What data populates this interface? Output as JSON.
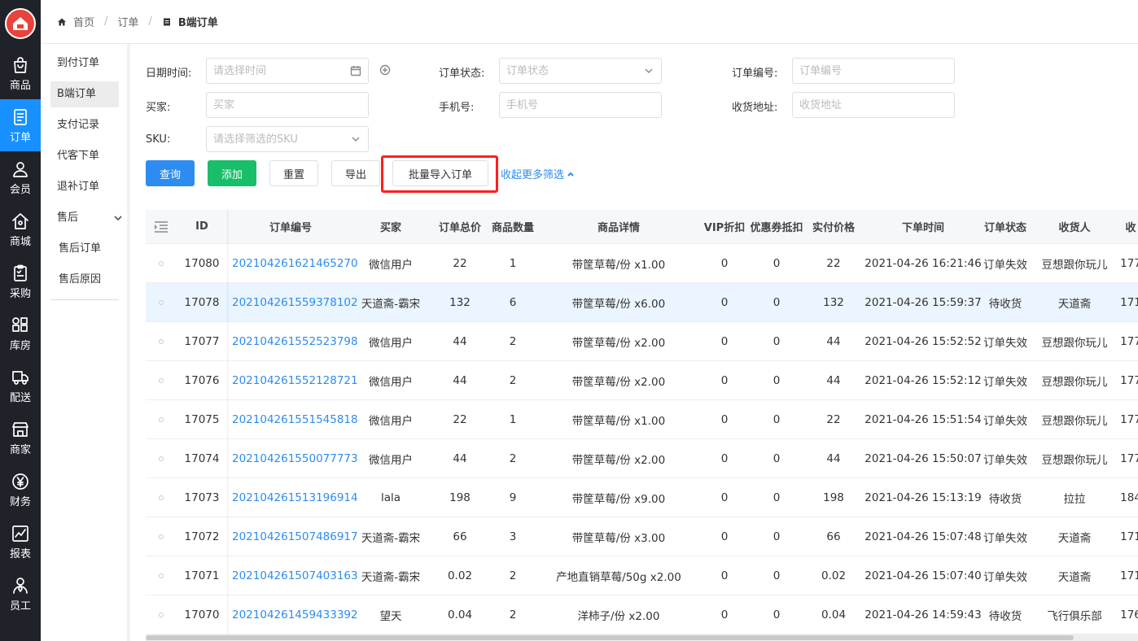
{
  "rail": {
    "items": [
      {
        "label": "商品",
        "icon": "shopping-bag-icon"
      },
      {
        "label": "订单",
        "icon": "order-doc-icon",
        "active": true
      },
      {
        "label": "会员",
        "icon": "user-icon"
      },
      {
        "label": "商城",
        "icon": "home-icon"
      },
      {
        "label": "采购",
        "icon": "clipboard-icon"
      },
      {
        "label": "库房",
        "icon": "warehouse-grid-icon"
      },
      {
        "label": "配送",
        "icon": "truck-icon"
      },
      {
        "label": "商家",
        "icon": "store-icon"
      },
      {
        "label": "财务",
        "icon": "yen-icon"
      },
      {
        "label": "报表",
        "icon": "chart-icon"
      },
      {
        "label": "员工",
        "icon": "staff-icon"
      }
    ]
  },
  "breadcrumb": {
    "home": "首页",
    "parent": "订单",
    "current": "B端订单"
  },
  "submenu": {
    "items": [
      "到付订单",
      "B端订单",
      "支付记录",
      "代客下单",
      "退补订单"
    ],
    "group": "售后",
    "group_children": [
      "售后订单",
      "售后原因"
    ]
  },
  "filters": {
    "date_label": "日期时间:",
    "date_placeholder": "请选择时间",
    "status_label": "订单状态:",
    "status_placeholder": "订单状态",
    "order_no_label": "订单编号:",
    "order_no_placeholder": "订单编号",
    "buyer_label": "买家:",
    "buyer_placeholder": "买家",
    "phone_label": "手机号:",
    "phone_placeholder": "手机号",
    "address_label": "收货地址:",
    "address_placeholder": "收货地址",
    "sku_label": "SKU:",
    "sku_placeholder": "请选择筛选的SKU"
  },
  "actions": {
    "query": "查询",
    "add": "添加",
    "reset": "重置",
    "export": "导出",
    "batch_import": "批量导入订单",
    "collapse": "收起更多筛选"
  },
  "colors": {
    "primary": "#2d8cf0",
    "success": "#19be6b",
    "rail_bg": "#20222a",
    "highlight": "#ff1f1f"
  },
  "table": {
    "headers": [
      "ID",
      "订单编号",
      "买家",
      "订单总价",
      "商品数量",
      "商品详情",
      "VIP折扣",
      "优惠券抵扣",
      "实付价格",
      "下单时间",
      "订单状态",
      "收货人",
      "收"
    ],
    "rows": [
      [
        "17080",
        "202104261621465270",
        "微信用户",
        "22",
        "1",
        "带筐草莓/份 x1.00",
        "0",
        "0",
        "22",
        "2021-04-26 16:21:46",
        "订单失效",
        "豆想跟你玩儿",
        "177"
      ],
      [
        "17078",
        "202104261559378102",
        "天道斋-霸宋",
        "132",
        "6",
        "带筐草莓/份 x6.00",
        "0",
        "0",
        "132",
        "2021-04-26 15:59:37",
        "待收货",
        "天道斋",
        "171"
      ],
      [
        "17077",
        "202104261552523798",
        "微信用户",
        "44",
        "2",
        "带筐草莓/份 x2.00",
        "0",
        "0",
        "44",
        "2021-04-26 15:52:52",
        "订单失效",
        "豆想跟你玩儿",
        "177"
      ],
      [
        "17076",
        "202104261552128721",
        "微信用户",
        "44",
        "2",
        "带筐草莓/份 x2.00",
        "0",
        "0",
        "44",
        "2021-04-26 15:52:12",
        "订单失效",
        "豆想跟你玩儿",
        "177"
      ],
      [
        "17075",
        "202104261551545818",
        "微信用户",
        "22",
        "1",
        "带筐草莓/份 x1.00",
        "0",
        "0",
        "22",
        "2021-04-26 15:51:54",
        "订单失效",
        "豆想跟你玩儿",
        "177"
      ],
      [
        "17074",
        "202104261550077773",
        "微信用户",
        "44",
        "2",
        "带筐草莓/份 x2.00",
        "0",
        "0",
        "44",
        "2021-04-26 15:50:07",
        "订单失效",
        "豆想跟你玩儿",
        "177"
      ],
      [
        "17073",
        "202104261513196914",
        "lala",
        "198",
        "9",
        "带筐草莓/份 x9.00",
        "0",
        "0",
        "198",
        "2021-04-26 15:13:19",
        "待收货",
        "拉拉",
        "184"
      ],
      [
        "17072",
        "202104261507486917",
        "天道斋-霸宋",
        "66",
        "3",
        "带筐草莓/份 x3.00",
        "0",
        "0",
        "66",
        "2021-04-26 15:07:48",
        "订单失效",
        "天道斋",
        "171"
      ],
      [
        "17071",
        "202104261507403163",
        "天道斋-霸宋",
        "0.02",
        "2",
        "产地直销草莓/50g x2.00",
        "0",
        "0",
        "0.02",
        "2021-04-26 15:07:40",
        "订单失效",
        "天道斋",
        "171"
      ],
      [
        "17070",
        "202104261459433392",
        "望天",
        "0.04",
        "2",
        "洋柿子/份 x2.00",
        "0",
        "0",
        "0.04",
        "2021-04-26 14:59:43",
        "待收货",
        "飞行俱乐部",
        "176"
      ]
    ]
  }
}
